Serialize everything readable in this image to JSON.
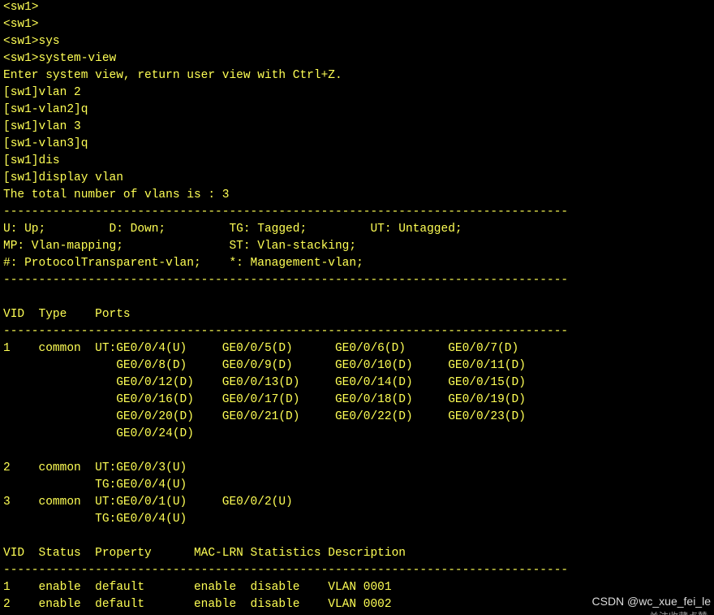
{
  "colors": {
    "background": "#000000",
    "terminal_text": "#ffff55",
    "watermark_text": "#dcdcdc"
  },
  "terminal": {
    "lines": [
      "<sw1>",
      "<sw1>",
      "<sw1>sys",
      "<sw1>system-view",
      "Enter system view, return user view with Ctrl+Z.",
      "[sw1]vlan 2",
      "[sw1-vlan2]q",
      "[sw1]vlan 3",
      "[sw1-vlan3]q",
      "[sw1]dis",
      "[sw1]display vlan",
      "The total number of vlans is : 3",
      "--------------------------------------------------------------------------------",
      "U: Up;         D: Down;         TG: Tagged;         UT: Untagged;",
      "MP: Vlan-mapping;               ST: Vlan-stacking;",
      "#: ProtocolTransparent-vlan;    *: Management-vlan;",
      "--------------------------------------------------------------------------------",
      "",
      "VID  Type    Ports",
      "--------------------------------------------------------------------------------",
      "1    common  UT:GE0/0/4(U)     GE0/0/5(D)      GE0/0/6(D)      GE0/0/7(D)",
      "                GE0/0/8(D)     GE0/0/9(D)      GE0/0/10(D)     GE0/0/11(D)",
      "                GE0/0/12(D)    GE0/0/13(D)     GE0/0/14(D)     GE0/0/15(D)",
      "                GE0/0/16(D)    GE0/0/17(D)     GE0/0/18(D)     GE0/0/19(D)",
      "                GE0/0/20(D)    GE0/0/21(D)     GE0/0/22(D)     GE0/0/23(D)",
      "                GE0/0/24(D)",
      "",
      "2    common  UT:GE0/0/3(U)",
      "             TG:GE0/0/4(U)",
      "3    common  UT:GE0/0/1(U)     GE0/0/2(U)",
      "             TG:GE0/0/4(U)",
      "",
      "VID  Status  Property      MAC-LRN Statistics Description",
      "--------------------------------------------------------------------------------",
      "1    enable  default       enable  disable    VLAN 0001",
      "2    enable  default       enable  disable    VLAN 0002"
    ]
  },
  "watermark": {
    "text": "CSDN @wc_xue_fei_le",
    "subtext": "关注收藏点赞"
  }
}
